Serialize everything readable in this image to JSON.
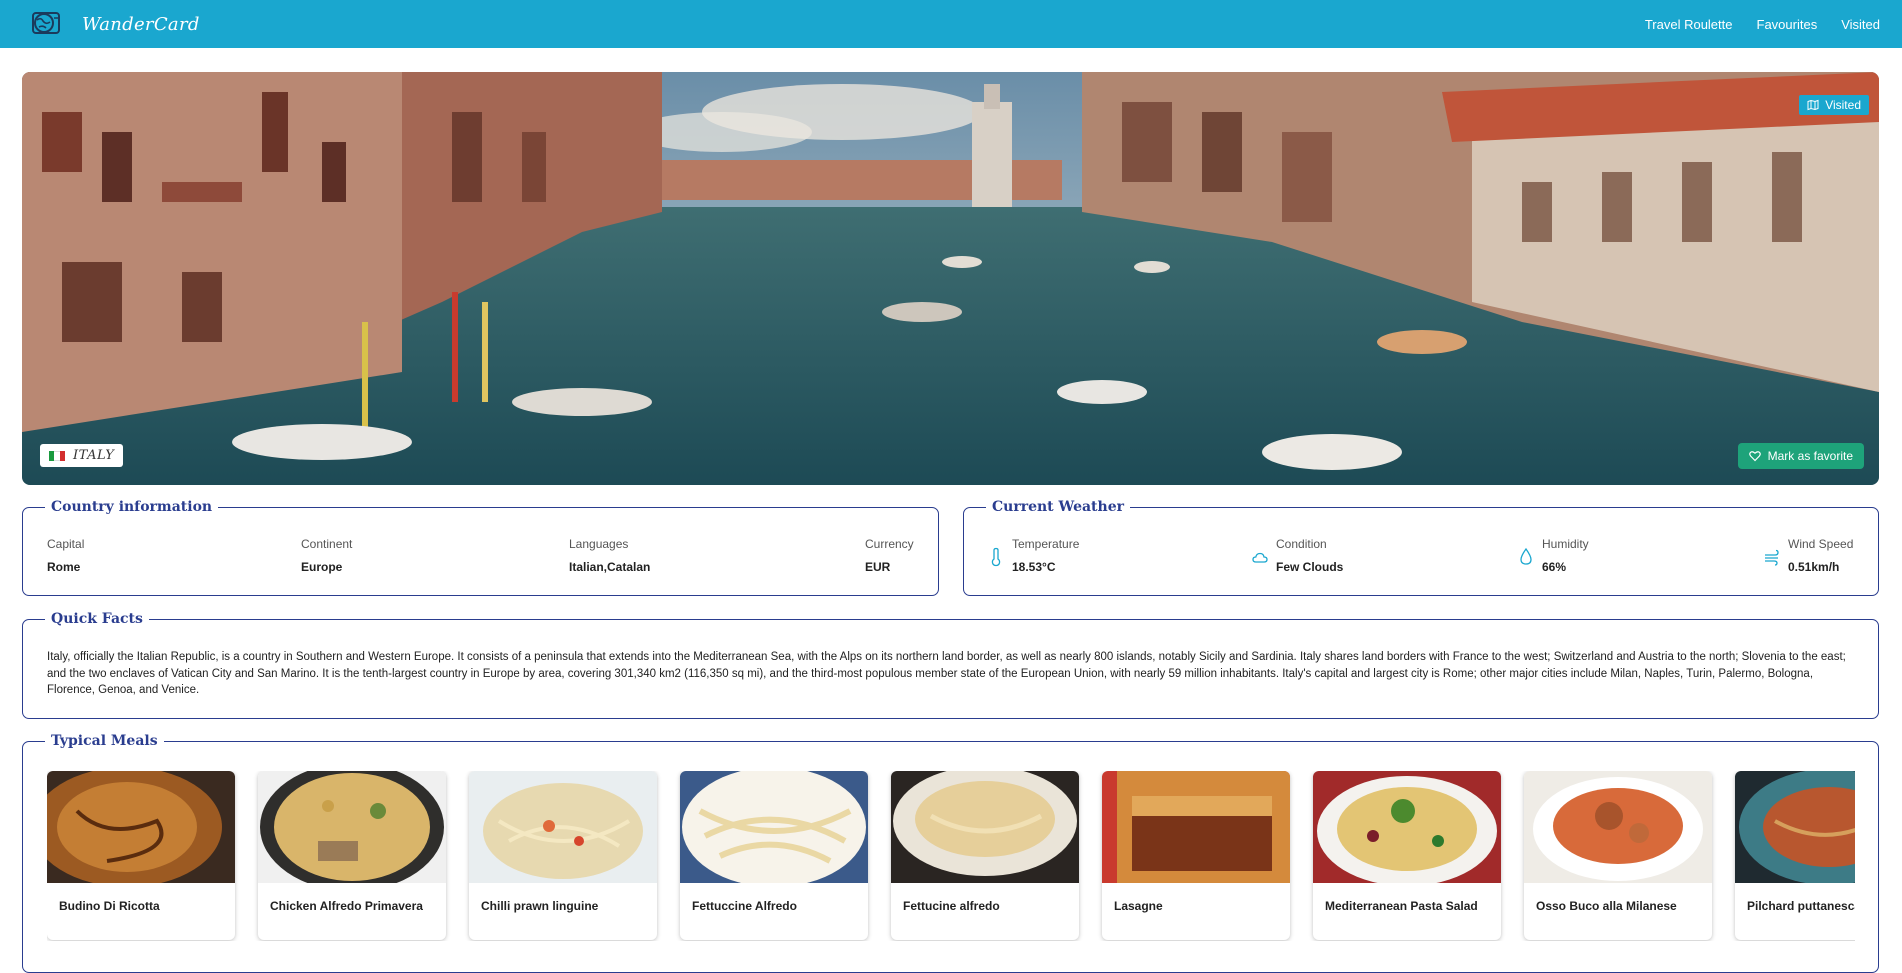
{
  "app": {
    "name": "WanderCard",
    "logo_icon": "globe-card-icon",
    "brand_color": "#1aa7cf"
  },
  "nav": {
    "links": [
      "Travel Roulette",
      "Favourites",
      "Visited"
    ]
  },
  "hero": {
    "visited_label": "Visited",
    "visited_icon": "map-icon",
    "country_name": "ITALY",
    "flag_colors": [
      "#1a9a3e",
      "#ffffff",
      "#d32e2e"
    ],
    "favorite_label": "Mark as favorite",
    "favorite_icon": "heart-icon",
    "favorite_color": "#1ea37a"
  },
  "country_info": {
    "title": "Country information",
    "capital_label": "Capital",
    "capital": "Rome",
    "continent_label": "Continent",
    "continent": "Europe",
    "languages_label": "Languages",
    "languages": "Italian,Catalan",
    "currency_label": "Currency",
    "currency": "EUR"
  },
  "weather": {
    "title": "Current Weather",
    "temperature_label": "Temperature",
    "temperature": "18.53°C",
    "temperature_icon": "thermometer-icon",
    "condition_label": "Condition",
    "condition": "Few Clouds",
    "condition_icon": "cloud-icon",
    "humidity_label": "Humidity",
    "humidity": "66%",
    "humidity_icon": "droplet-icon",
    "wind_label": "Wind Speed",
    "wind": "0.51km/h",
    "wind_icon": "wind-icon",
    "icon_color": "#1aa7cf"
  },
  "quick_facts": {
    "title": "Quick Facts",
    "text": "Italy, officially the Italian Republic, is a country in Southern and Western Europe. It consists of a peninsula that extends into the Mediterranean Sea, with the Alps on its northern land border, as well as nearly 800 islands, notably Sicily and Sardinia. Italy shares land borders with France to the west; Switzerland and Austria to the north; Slovenia to the east; and the two enclaves of Vatican City and San Marino. It is the tenth-largest country in Europe by area, covering 301,340 km2 (116,350 sq mi), and the third-most populous member state of the European Union, with nearly 59 million inhabitants. Italy's capital and largest city is Rome; other major cities include Milan, Naples, Turin, Palermo, Bologna, Florence, Genoa, and Venice."
  },
  "meals": {
    "title": "Typical Meals",
    "items": [
      {
        "name": "Budino Di Ricotta"
      },
      {
        "name": "Chicken Alfredo Primavera"
      },
      {
        "name": "Chilli prawn linguine"
      },
      {
        "name": "Fettuccine Alfredo"
      },
      {
        "name": "Fettucine alfredo"
      },
      {
        "name": "Lasagne"
      },
      {
        "name": "Mediterranean Pasta Salad"
      },
      {
        "name": "Osso Buco alla Milanese"
      },
      {
        "name": "Pilchard puttanesca"
      }
    ]
  }
}
